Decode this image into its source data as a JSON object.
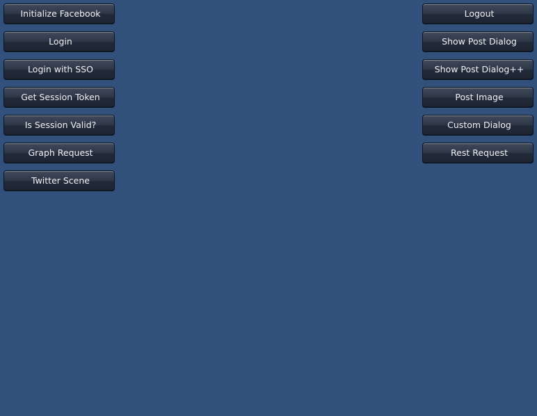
{
  "left_buttons": [
    {
      "label": "Initialize Facebook"
    },
    {
      "label": "Login"
    },
    {
      "label": "Login with SSO"
    },
    {
      "label": "Get Session Token"
    },
    {
      "label": "Is Session Valid?"
    },
    {
      "label": "Graph Request"
    },
    {
      "label": "Twitter Scene"
    }
  ],
  "right_buttons": [
    {
      "label": "Logout"
    },
    {
      "label": "Show Post Dialog"
    },
    {
      "label": "Show Post Dialog++"
    },
    {
      "label": "Post Image"
    },
    {
      "label": "Custom Dialog"
    },
    {
      "label": "Rest Request"
    }
  ],
  "colors": {
    "background": "#31507b",
    "button_top": "#3d4656",
    "button_bottom": "#1d2432",
    "button_text": "#f0f2f6"
  }
}
